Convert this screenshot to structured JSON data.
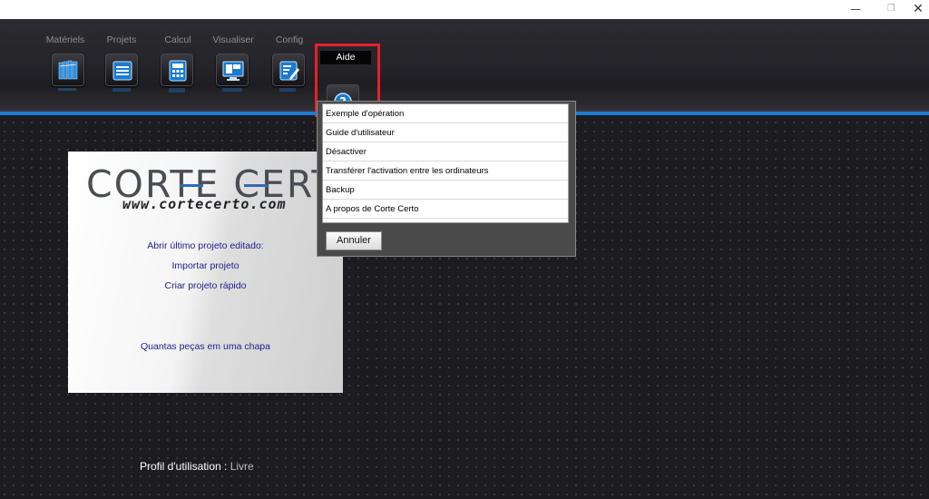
{
  "window": {
    "minimize_glyph": "—",
    "maximize_glyph": "❐",
    "close_glyph": "✕"
  },
  "toolbar": {
    "items": [
      {
        "label": "Matériels",
        "icon": "materials-icon"
      },
      {
        "label": "Projets",
        "icon": "projects-icon"
      },
      {
        "label": "Calcul",
        "icon": "calculator-icon"
      },
      {
        "label": "Visualiser",
        "icon": "visualize-icon"
      },
      {
        "label": "Config",
        "icon": "config-icon"
      }
    ],
    "help": {
      "label": "Aide",
      "icon": "help-icon"
    }
  },
  "help_menu": {
    "items": [
      "Exemple d'opération",
      "Guide d'utilisateur",
      "Désactiver",
      "Transférer l'activation entre les ordinateurs",
      "Backup",
      "A propos de Corte Certo"
    ],
    "cancel_label": "Annuler"
  },
  "welcome": {
    "logo_text": "CORTE CERTO",
    "logo_url": "www.cortecerto.com",
    "links": {
      "open_last": "Abrir último projeto editado:",
      "import": "Importar projeto",
      "quick": "Criar projeto rápido",
      "pieces": "Quantas peças em uma chapa"
    }
  },
  "profile": {
    "label": "Profil d'utilisation :",
    "value": "Livre"
  },
  "colors": {
    "accent_blue": "#1e7ad6",
    "highlight_red": "#e8202a",
    "link_blue": "#1c1c8c"
  }
}
